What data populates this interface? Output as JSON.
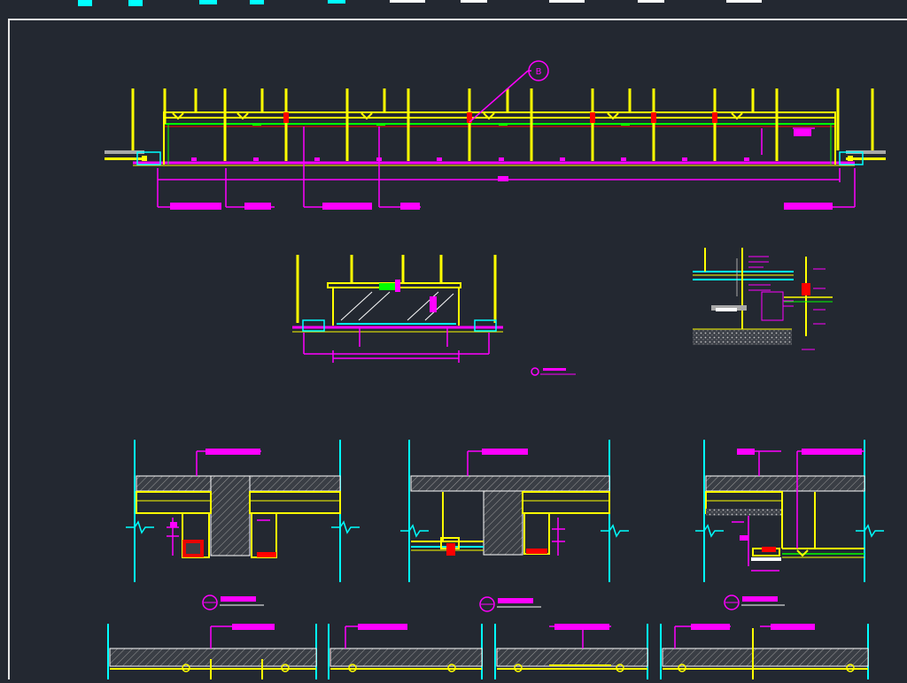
{
  "app": {
    "type": "CAD drawing viewer",
    "mode": "model space",
    "background": "#232831"
  },
  "colors": {
    "background": "#232831",
    "border": "#e6e6e6",
    "yellow": "#ffff00",
    "magenta": "#ff00ff",
    "cyan": "#00ffff",
    "green": "#00ff00",
    "red": "#ff0000",
    "white": "#ffffff",
    "gray": "#a8a8a8"
  },
  "drawing": {
    "layers": [
      "ceiling-section",
      "suspension-rods",
      "dimensions",
      "hatch-concrete",
      "annotations"
    ],
    "callout_bubble_text": "B"
  }
}
